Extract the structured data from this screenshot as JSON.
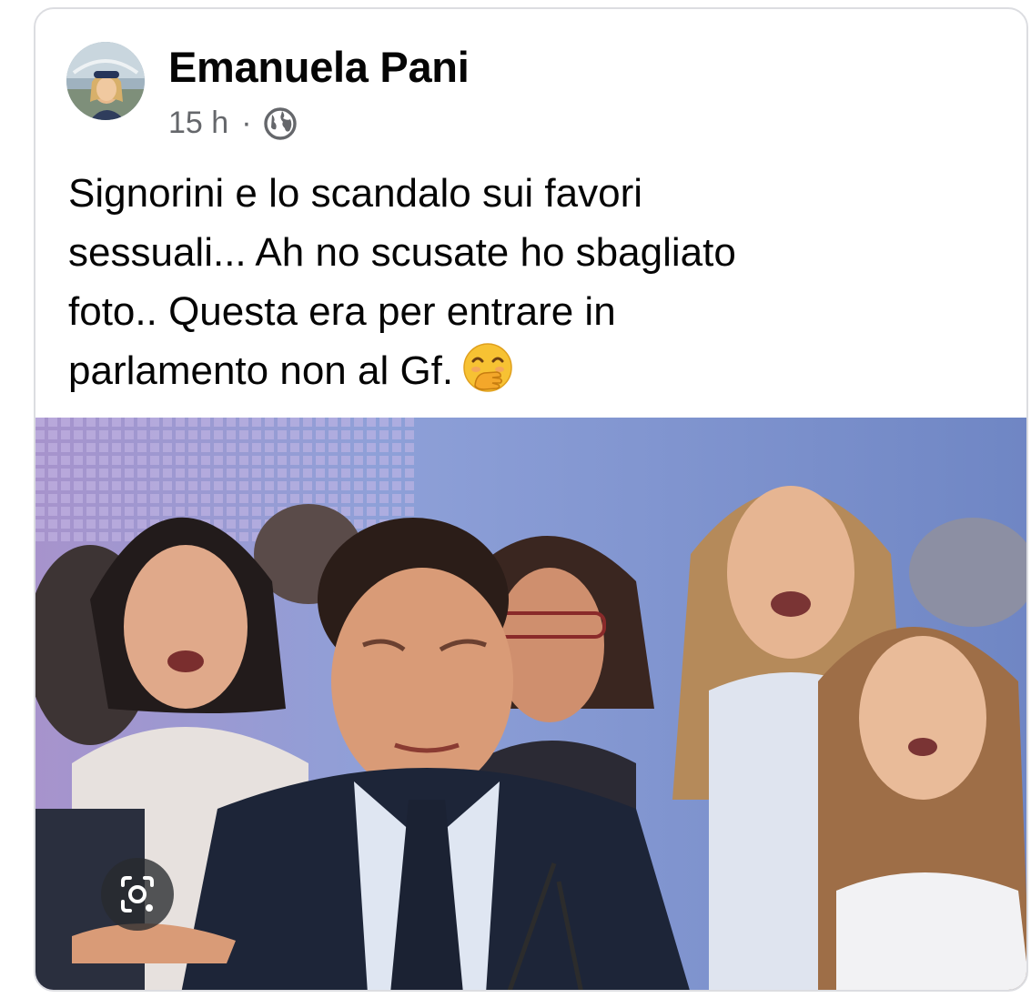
{
  "post": {
    "author": "Emanuela Pani",
    "time": "15 h",
    "separator": "·",
    "privacy_icon": "globe-icon",
    "text_lines": [
      "Signorini e lo scandalo sui favori",
      "sessuali... Ah no scusate ho sbagliato",
      "foto.. Questa era per entrare in",
      "parlamento non al Gf."
    ],
    "emoji": "face-with-hand-over-mouth"
  },
  "photo": {
    "overlay_icon": "visual-search-camera-icon"
  },
  "colors": {
    "text": "#050505",
    "secondary_text": "#65676b",
    "card_border": "#dcdde1",
    "photo_backdrop": "#6f86c4"
  }
}
